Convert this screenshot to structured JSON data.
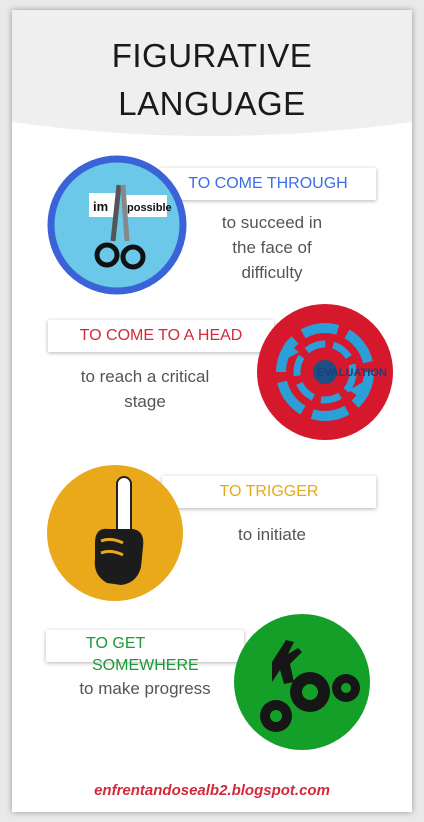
{
  "title": {
    "line1": "FIGURATIVE",
    "line2": "LANGUAGE"
  },
  "items": [
    {
      "phrase": "TO COME THROUGH",
      "meaning": [
        "to succeed in",
        "the face of",
        "difficulty"
      ],
      "color": "#3a6ee8",
      "image_text": [
        "im",
        "possible"
      ],
      "icon": "scissors-icon"
    },
    {
      "phrase": "TO COME TO A HEAD",
      "meaning": [
        "to reach a critical",
        "stage"
      ],
      "color": "#d3293b",
      "image_text": [
        "EVALUATION"
      ],
      "icon": "target-arrows-icon"
    },
    {
      "phrase": "TO TRIGGER",
      "meaning": [
        "to initiate"
      ],
      "color": "#e6a917",
      "icon": "raised-finger-icon"
    },
    {
      "phrase": "TO GET SOMEWHERE",
      "phrase_lines": [
        "TO GET",
        "SOMEWHERE"
      ],
      "meaning": [
        "to make progress"
      ],
      "color": "#1a9a36",
      "icon": "climber-gears-icon"
    }
  ],
  "footer": {
    "url": "enfrentandosealb2.blogspot.com",
    "color": "#d3293b"
  }
}
